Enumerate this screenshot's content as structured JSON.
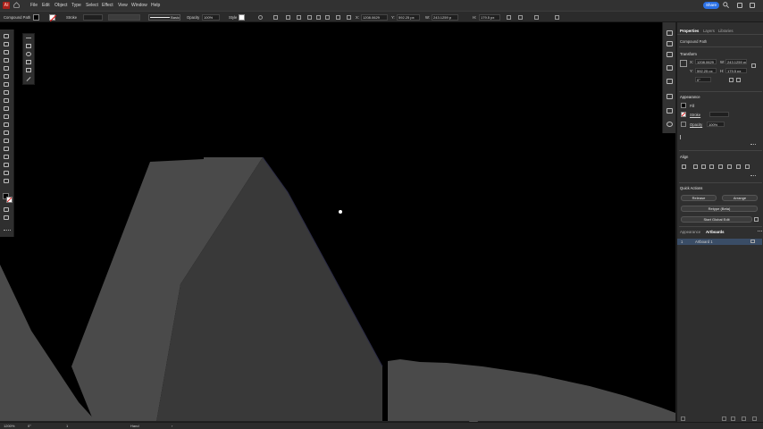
{
  "app": {
    "name": "Adobe Illustrator",
    "logo_text": "Ai"
  },
  "menu": {
    "items": [
      "File",
      "Edit",
      "Object",
      "Type",
      "Select",
      "Effect",
      "View",
      "Window",
      "Help"
    ],
    "share_label": "Share"
  },
  "control_bar": {
    "selection_type": "Compound Path",
    "stroke_label": "Stroke",
    "stroke_profile": "Basic",
    "opacity_label": "Opacity",
    "opacity_value": "100%",
    "style_label": "Style",
    "x_value": "1208.0629",
    "y_value": "592.25 px",
    "w_label": "W:",
    "w_value": "243.1259 p",
    "h_label": "H:",
    "h_value": "179.5 px",
    "fill_color": "#000000",
    "stroke_color": "#c0262a"
  },
  "right_panel": {
    "tabs": [
      "Properties",
      "Layers",
      "Libraries"
    ],
    "compound_path_label": "Compound Path",
    "transform": {
      "title": "Transform",
      "x_label": "X:",
      "x_value": "1208.0629",
      "y_label": "Y:",
      "y_value": "592.25 px",
      "w_label": "W:",
      "w_value": "243.1259 px",
      "h_label": "H:",
      "h_value": "179.5 px",
      "angle_value": "0°"
    },
    "appearance": {
      "title": "Appearance",
      "fill_label": "Fill",
      "stroke_label": "Stroke",
      "opacity_label": "Opacity",
      "opacity_value": "100%"
    },
    "align_title": "Align",
    "quick_actions": {
      "title": "Quick Actions",
      "release_label": "Release",
      "arrange_label": "Arrange",
      "retype_label": "Retype (Beta)",
      "global_edit_label": "Start Global Edit"
    },
    "bottom_tabs": [
      "Appearance",
      "Artboards"
    ],
    "artboard_index": "1",
    "artboard_name": "Artboard 1"
  },
  "status_bar": {
    "zoom": "1200%",
    "rotation": "0°",
    "artboard_nav": "1",
    "tool_name": "Hand"
  },
  "colors": {
    "accent": "#2b71e6",
    "shape_light": "#4a4a4a",
    "shape_dark": "#3a3a3a",
    "canvas": "#000000"
  }
}
